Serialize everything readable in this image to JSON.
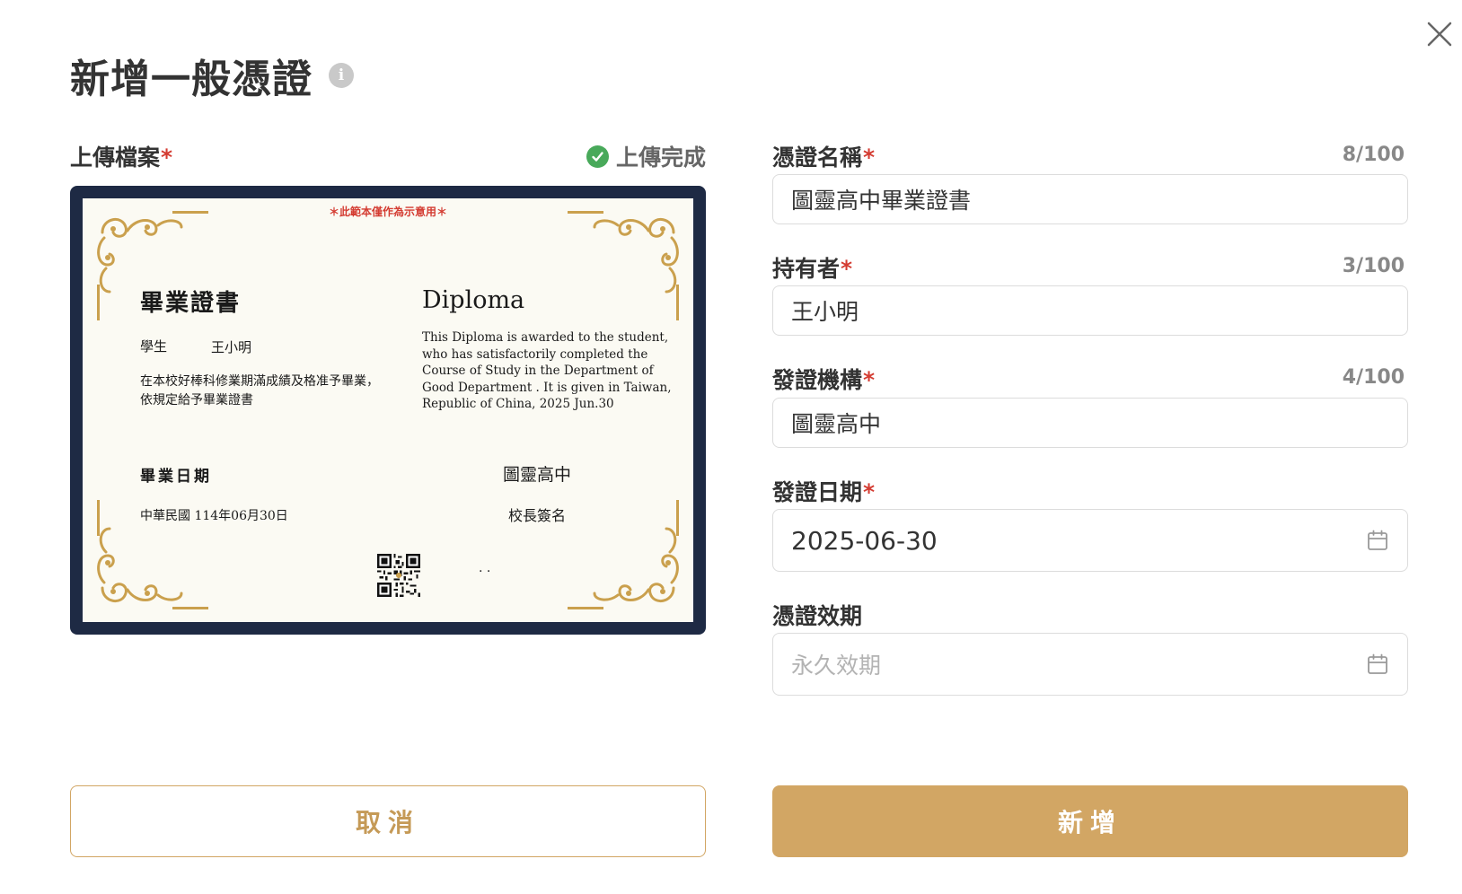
{
  "dialog": {
    "title": "新增一般憑證",
    "info_icon": "info-icon",
    "close_icon": "close-icon"
  },
  "upload": {
    "label": "上傳檔案",
    "required_mark": "*",
    "status_text": "上傳完成",
    "status_icon": "check-circle-icon",
    "status_color": "#48a95a"
  },
  "certificate_preview": {
    "note": "＊此範本僅作為示意用＊",
    "title_zh": "畢業證書",
    "title_en": "Diploma",
    "student_label": "學生",
    "student_name": "王小明",
    "body_zh": "在本校好棒科修業期滿成績及格准予畢業，依規定給予畢業證書",
    "body_en": "This Diploma is awarded to the student, who has satisfactorily completed the Course of Study in the Department of Good Department . It is given in Taiwan, Republic of China, 2025 Jun.30",
    "date_label": "畢業日期",
    "date_value": "中華民國 114年06月30日",
    "issuer": "圖靈高中",
    "principal_label": "校長簽名",
    "dots": ". .",
    "frame_color": "#1e2a44",
    "ornament_color": "#caa04d"
  },
  "form": {
    "credential_name": {
      "label": "憑證名稱",
      "required_mark": "*",
      "counter": "8/100",
      "value": "圖靈高中畢業證書"
    },
    "holder": {
      "label": "持有者",
      "required_mark": "*",
      "counter": "3/100",
      "value": "王小明"
    },
    "issuer": {
      "label": "發證機構",
      "required_mark": "*",
      "counter": "4/100",
      "value": "圖靈高中"
    },
    "issue_date": {
      "label": "發證日期",
      "required_mark": "*",
      "value": "2025-06-30",
      "icon": "calendar-icon"
    },
    "validity": {
      "label": "憑證效期",
      "placeholder": "永久效期",
      "icon": "calendar-icon"
    }
  },
  "actions": {
    "cancel_label": "取消",
    "submit_label": "新增",
    "accent_color": "#d2a664"
  }
}
